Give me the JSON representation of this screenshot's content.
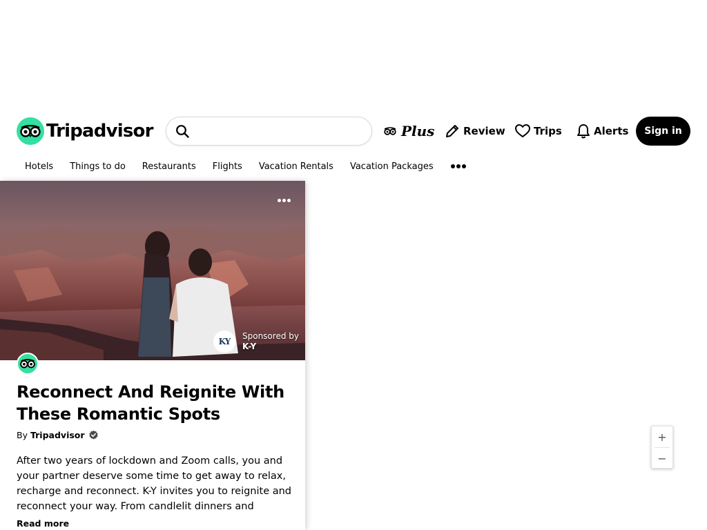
{
  "header": {
    "logo_text": "Tripadvisor",
    "search": {
      "placeholder": "",
      "value": ""
    },
    "plus_label": "Plus",
    "review_label": "Review",
    "trips_label": "Trips",
    "alerts_label": "Alerts",
    "signin_label": "Sign in"
  },
  "nav": {
    "items": [
      "Hotels",
      "Things to do",
      "Restaurants",
      "Flights",
      "Vacation Rentals",
      "Vacation Packages"
    ],
    "more_icon": "more-dots-icon"
  },
  "card": {
    "menu_icon": "more-dots-icon",
    "sponsor": {
      "logo_text": "KY",
      "by_label": "Sponsored by",
      "name": "K-Y"
    },
    "title": "Reconnect And Reignite With These Romantic Spots",
    "byline_prefix": "By",
    "byline_author": "Tripadvisor",
    "description": "After two years of lockdown and Zoom calls, you and your partner deserve some time to get away to relax, recharge and reconnect. K-Y invites you to reignite and reconnect your way. From candlelit dinners and",
    "read_more": "Read more"
  },
  "map": {
    "zoom_in": "+",
    "zoom_out": "−"
  },
  "colors": {
    "brand_green": "#34e0a1",
    "signin_bg": "#000000",
    "text": "#000000"
  }
}
